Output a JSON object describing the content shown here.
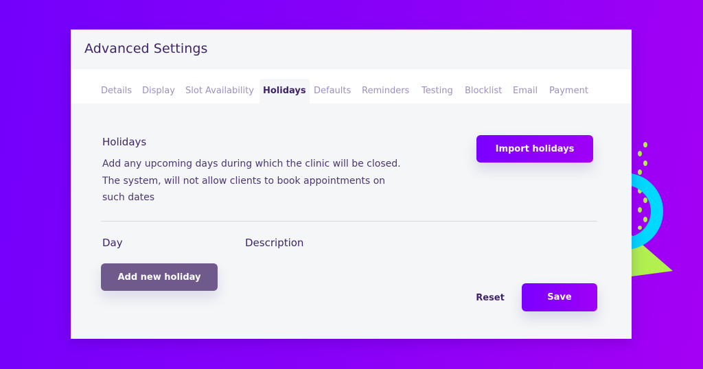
{
  "colors": {
    "background_start": "#7300fb",
    "background_end": "#a400f4",
    "primary_button": "#8a00fa",
    "secondary_button": "#6f5a8b",
    "text_dark": "#3f2468",
    "tab_inactive": "#9f8fbf",
    "decor_cyan": "#00d8ff",
    "decor_lime": "#b2f050"
  },
  "panel": {
    "title": "Advanced Settings"
  },
  "tabs": [
    {
      "label": "Details",
      "active": false
    },
    {
      "label": "Display",
      "active": false
    },
    {
      "label": "Slot Availability",
      "active": false
    },
    {
      "label": "Holidays",
      "active": true
    },
    {
      "label": "Defaults",
      "active": false
    },
    {
      "label": "Reminders",
      "active": false
    },
    {
      "label": "Testing",
      "active": false
    },
    {
      "label": "Blocklist",
      "active": false
    },
    {
      "label": "Email",
      "active": false
    },
    {
      "label": "Payment",
      "active": false
    }
  ],
  "holidays": {
    "title": "Holidays",
    "description": "Add any upcoming days during which the clinic will be closed. The system, will not allow clients to book appointments on such dates",
    "import_button": "Import holidays",
    "columns": {
      "day": "Day",
      "description": "Description"
    },
    "add_button": "Add new holiday"
  },
  "footer": {
    "reset_label": "Reset",
    "save_label": "Save"
  },
  "decor": {
    "ring_icon": "ring-shape",
    "triangle_icon": "triangle-shape",
    "dots_icon": "dot-pattern"
  }
}
